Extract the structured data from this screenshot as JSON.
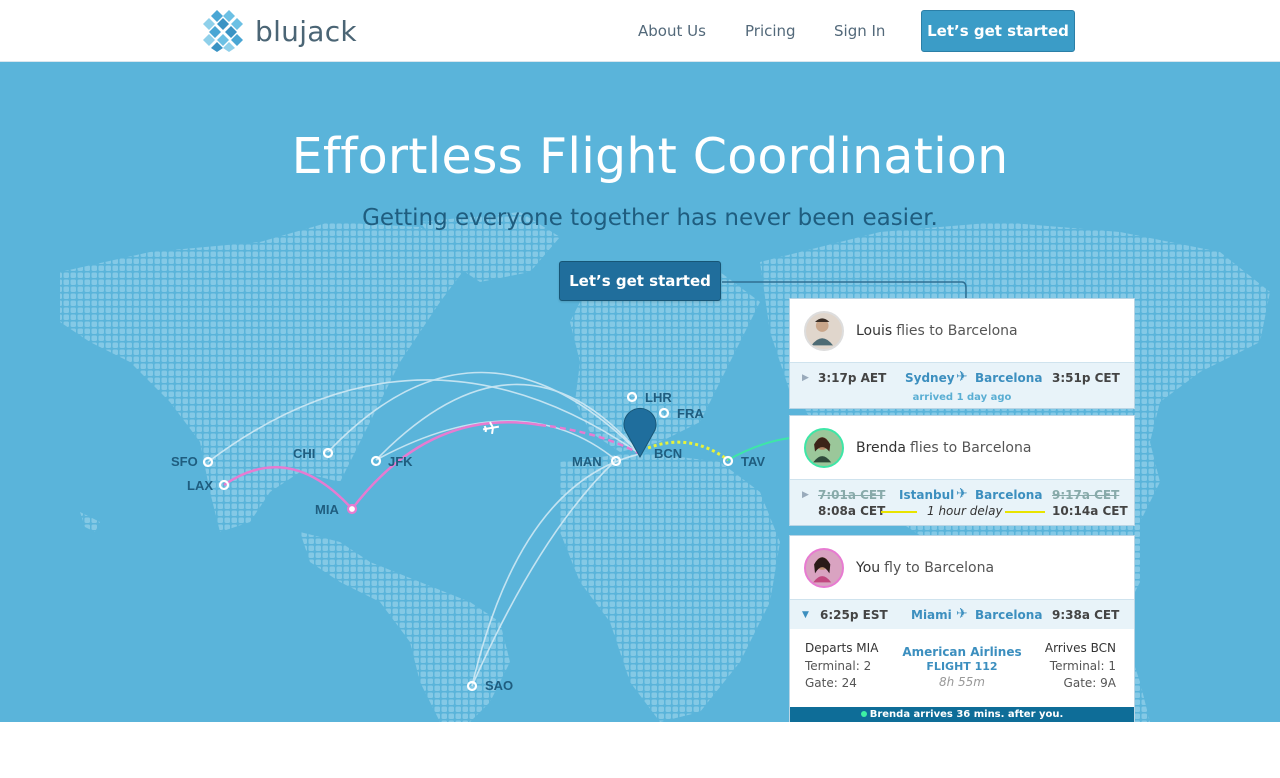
{
  "brand": {
    "name": "blujack",
    "accent": "#3b9cc7",
    "hero_bg": "#5ab4da"
  },
  "nav": {
    "links": [
      "About Us",
      "Pricing",
      "Sign In"
    ],
    "cta": "Let’s get started"
  },
  "hero": {
    "title": "Effortless Flight Coordination",
    "subtitle": "Getting everyone together has never been easier.",
    "cta": "Let’s get started"
  },
  "map": {
    "airports": [
      "SFO",
      "LAX",
      "CHI",
      "JFK",
      "MIA",
      "SAO",
      "LHR",
      "FRA",
      "MAN",
      "BCN",
      "TAV"
    ]
  },
  "cards": [
    {
      "name": "Louis",
      "action": "flies to Barcelona",
      "dep_time": "3:17p AET",
      "from": "Sydney",
      "to": "Barcelona",
      "arr_time": "3:51p CET",
      "note": "arrived 1 day ago"
    },
    {
      "name": "Brenda",
      "action": "flies to Barcelona",
      "old_dep": "7:01a CET",
      "from": "Istanbul",
      "to": "Barcelona",
      "old_arr": "9:17a CET",
      "dep_time": "8:08a CET",
      "delay": "1 hour delay",
      "arr_time": "10:14a CET"
    },
    {
      "name": "You",
      "action": "fly to Barcelona",
      "dep_time": "6:25p EST",
      "from": "Miami",
      "to": "Barcelona",
      "arr_time": "9:38a  CET",
      "departs": "Departs MIA",
      "dep_terminal": "Terminal: 2",
      "dep_gate": "Gate: 24",
      "airline": "American Airlines",
      "flight": "FLIGHT 112",
      "duration": "8h 55m",
      "arrives": "Arrives BCN",
      "arr_terminal": "Terminal: 1",
      "arr_gate": "Gate: 9A",
      "footer": "Brenda arrives 36 mins. after you."
    }
  ]
}
